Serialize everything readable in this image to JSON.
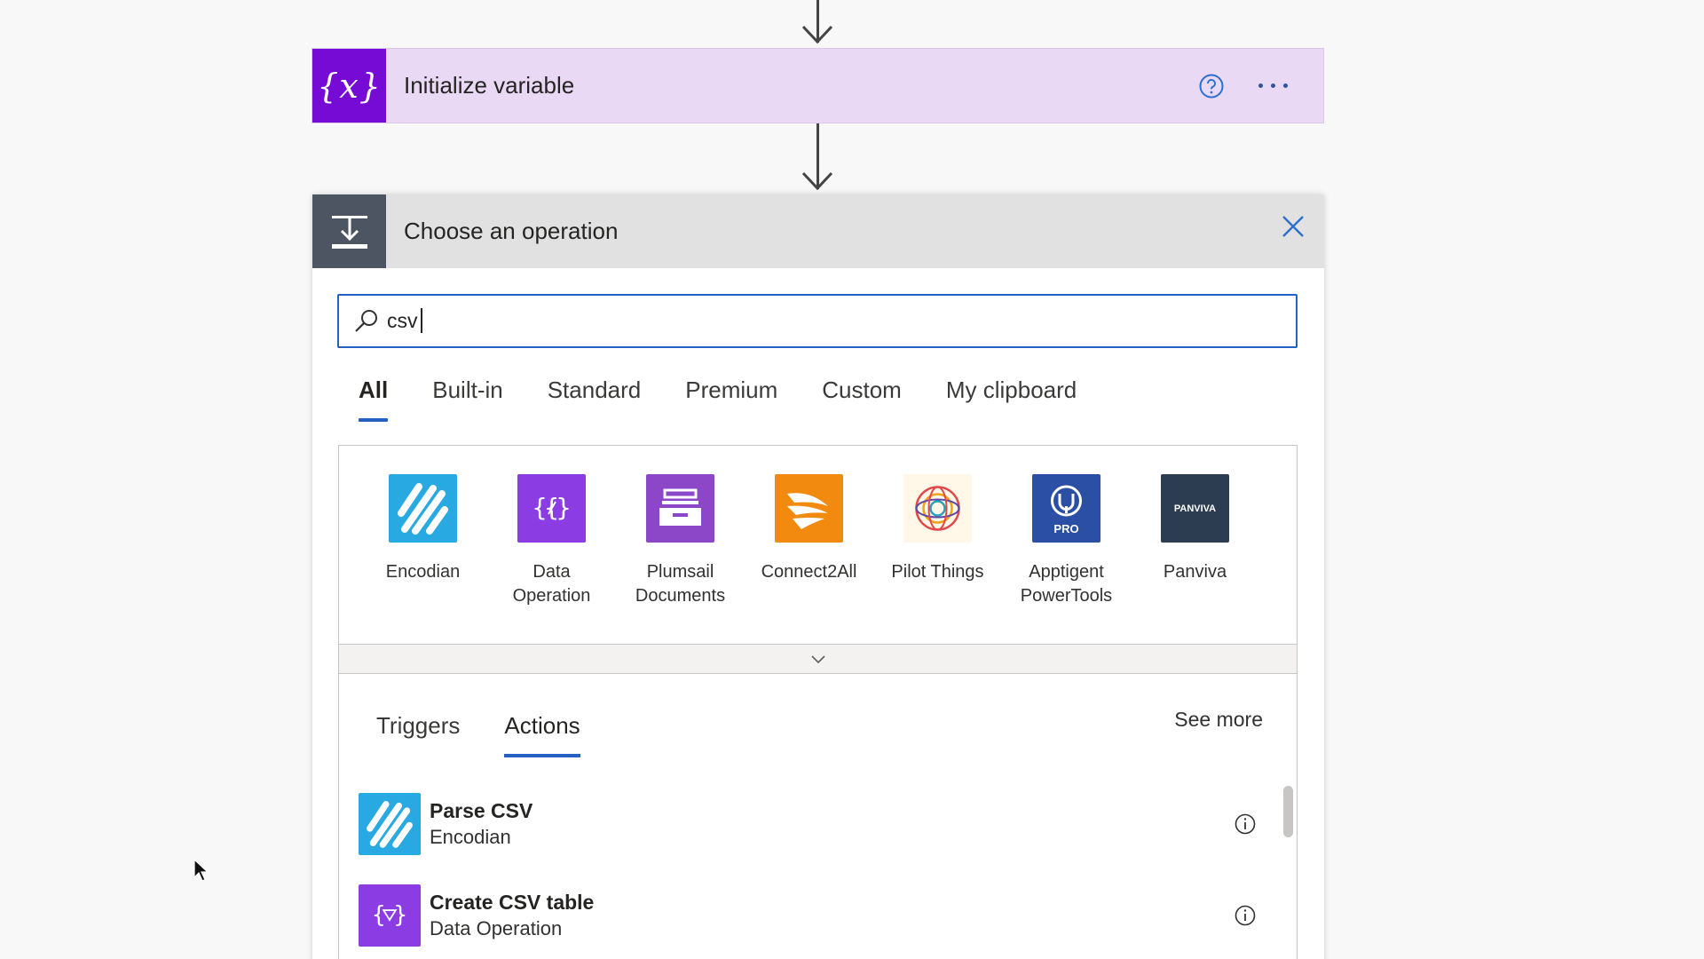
{
  "variable_step": {
    "icon": "variable-braces-icon",
    "icon_glyph": "{x}",
    "title": "Initialize variable",
    "accent": "#770bd6",
    "card_bg": "#e9d9f5"
  },
  "operation_panel": {
    "title": "Choose an operation",
    "header_icon": "operation-insert-icon",
    "search": {
      "value": "csv",
      "placeholder": ""
    },
    "tabs": [
      {
        "label": "All",
        "active": true
      },
      {
        "label": "Built-in",
        "active": false
      },
      {
        "label": "Standard",
        "active": false
      },
      {
        "label": "Premium",
        "active": false
      },
      {
        "label": "Custom",
        "active": false
      },
      {
        "label": "My clipboard",
        "active": false
      }
    ],
    "connectors": [
      {
        "name": "Encodian",
        "color": "#29a9e1"
      },
      {
        "name": "Data\nOperation",
        "color": "#8c3ce3"
      },
      {
        "name": "Plumsail\nDocuments",
        "color": "#8c46c8"
      },
      {
        "name": "Connect2All",
        "color": "#f28a0f"
      },
      {
        "name": "Pilot Things",
        "color": "#fff8e8"
      },
      {
        "name": "Apptigent\nPowerTools",
        "color": "#2b4fa5"
      },
      {
        "name": "Panviva",
        "color": "#2d3d51"
      }
    ],
    "panviva_logo_text": "PANVIVA",
    "apptigent_badge": "PRO",
    "result_tabs": [
      {
        "label": "Triggers",
        "active": false
      },
      {
        "label": "Actions",
        "active": true
      }
    ],
    "see_more": "See more",
    "actions": [
      {
        "name": "Parse CSV",
        "connector": "Encodian"
      },
      {
        "name": "Create CSV table",
        "connector": "Data Operation"
      }
    ],
    "accent": "#2461c2"
  }
}
